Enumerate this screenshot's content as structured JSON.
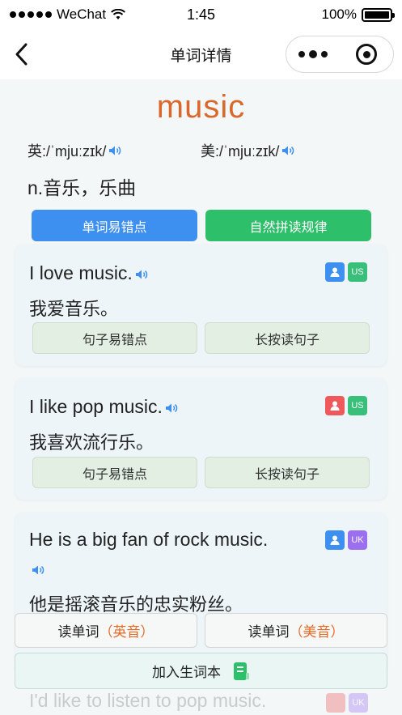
{
  "status_bar": {
    "carrier": "WeChat",
    "time": "1:45",
    "battery": "100%"
  },
  "nav": {
    "title": "单词详情"
  },
  "word": {
    "text": "music",
    "uk_phonetic": "英:/ˈmjuːzɪk/",
    "us_phonetic": "美:/ˈmjuːzɪk/",
    "meaning": "n.音乐，乐曲",
    "btn_mistakes": "单词易错点",
    "btn_phonics": "自然拼读规律"
  },
  "sentences": [
    {
      "en": "I love music.",
      "zh": "我爱音乐。",
      "btn_mistakes": "句子易错点",
      "btn_read": "长按读句子",
      "accent_badge": "US"
    },
    {
      "en": "I like pop music.",
      "zh": "我喜欢流行乐。",
      "btn_mistakes": "句子易错点",
      "btn_read": "长按读句子",
      "accent_badge": "US"
    },
    {
      "en": "He is a big fan of rock music.",
      "zh": "他是摇滚音乐的忠实粉丝。",
      "accent_badge": "UK"
    },
    {
      "en": "I'd like to listen to pop music.",
      "accent_badge": "UK"
    }
  ],
  "bottom": {
    "read_uk_prefix": "读单词",
    "read_uk_accent": "（英音）",
    "read_us_prefix": "读单词",
    "read_us_accent": "（美音）",
    "add_vocab": "加入生词本"
  },
  "colors": {
    "word": "#d9682a",
    "blue_button": "#3d8ff0",
    "green_button": "#2dbf6a",
    "accent_text": "#e66a24"
  }
}
